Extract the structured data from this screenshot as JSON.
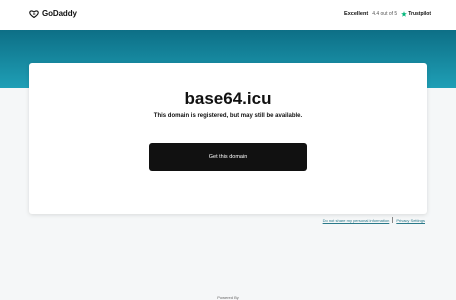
{
  "header": {
    "brand": "GoDaddy",
    "rating": {
      "label": "Excellent",
      "score_text": "4.4 out of 5",
      "provider": "Trustpilot"
    }
  },
  "card": {
    "domain": "base64.icu",
    "message": "This domain is registered, but may still be available.",
    "cta_label": "Get this domain"
  },
  "footer": {
    "links": [
      "Do not share my personal information",
      "Privacy Settings"
    ],
    "powered_by": "Powered By"
  },
  "colors": {
    "band": "#1a8aa3",
    "button": "#111111",
    "trustpilot_star": "#00b67a",
    "background": "#f5f7f8"
  },
  "icons": [
    "godaddy-logo-icon",
    "trustpilot-star-icon"
  ]
}
